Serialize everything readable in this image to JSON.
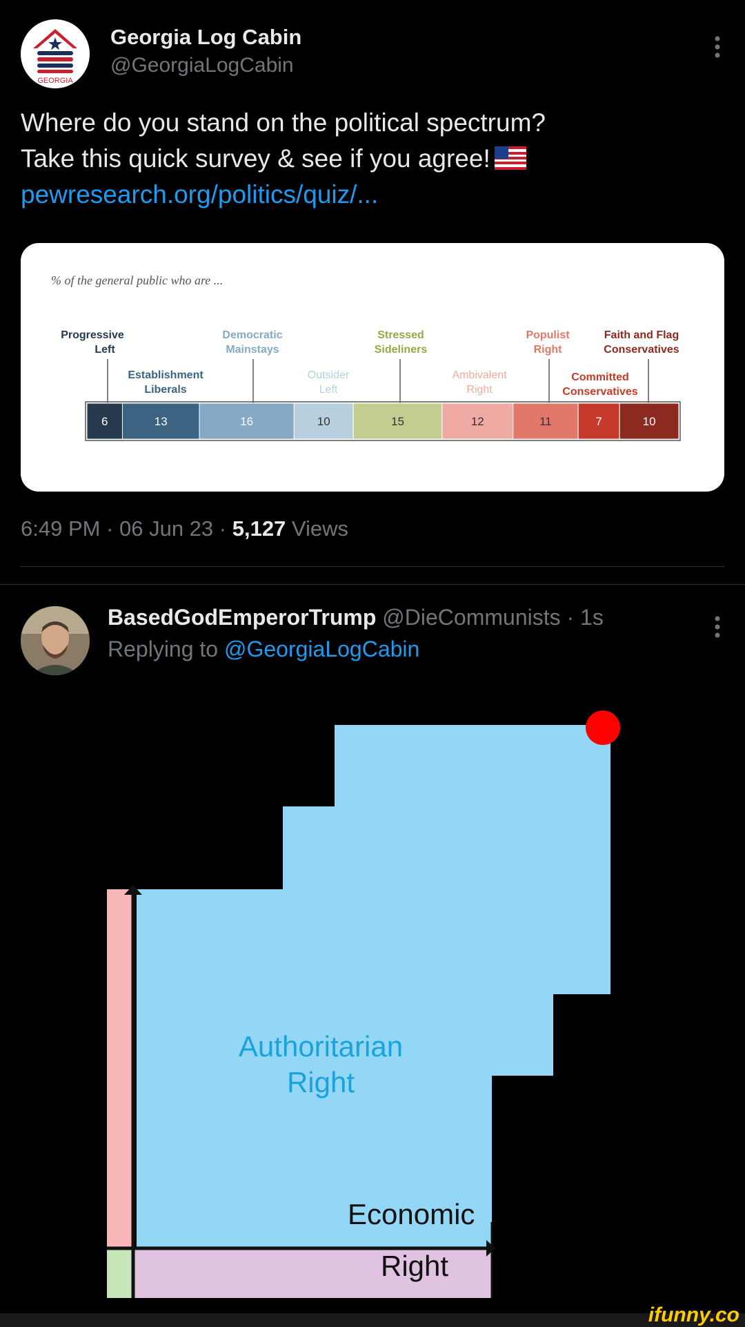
{
  "tweet": {
    "author_name": "Georgia Log Cabin",
    "author_handle": "@GeorgiaLogCabin",
    "avatar_text": "GEORGIA",
    "line1": "Where do you stand on the political spectrum?",
    "line2": "Take this quick survey & see if you agree!",
    "link": "pewresearch.org/politics/quiz/...",
    "timestamp": "6:49 PM · 06 Jun 23 · ",
    "views_count": "5,127",
    "views_label": " Views"
  },
  "card": {
    "caption": "% of the general public who are ...",
    "chart_data": {
      "type": "bar",
      "orientation": "horizontal-stacked",
      "unit": "%",
      "segments": [
        {
          "label": "Progressive Left",
          "value": 6,
          "color": "#26394d"
        },
        {
          "label": "Establishment Liberals",
          "value": 13,
          "color": "#3d6382"
        },
        {
          "label": "Democratic Mainstays",
          "value": 16,
          "color": "#85a9c5"
        },
        {
          "label": "Outsider Left",
          "value": 10,
          "color": "#b8cfe0"
        },
        {
          "label": "Stressed Sideliners",
          "value": 15,
          "color": "#c5cc8f"
        },
        {
          "label": "Ambivalent Right",
          "value": 12,
          "color": "#efaba3"
        },
        {
          "label": "Populist Right",
          "value": 11,
          "color": "#e2786b"
        },
        {
          "label": "Committed Conservatives",
          "value": 7,
          "color": "#c53a2b"
        },
        {
          "label": "Faith and Flag Conservatives",
          "value": 10,
          "color": "#8c2a1f"
        }
      ]
    },
    "labels": {
      "progressive_1": "Progressive",
      "progressive_2": "Left",
      "establishment_1": "Establishment",
      "establishment_2": "Liberals",
      "democratic_1": "Democratic",
      "democratic_2": "Mainstays",
      "outsider_1": "Outsider",
      "outsider_2": "Left",
      "stressed_1": "Stressed",
      "stressed_2": "Sideliners",
      "ambivalent_1": "Ambivalent",
      "ambivalent_2": "Right",
      "populist_1": "Populist",
      "populist_2": "Right",
      "committed_1": "Committed",
      "committed_2": "Conservatives",
      "faith_1": "Faith and Flag",
      "faith_2": "Conservatives"
    }
  },
  "reply": {
    "author_name": "BasedGodEmperorTrump",
    "author_handle": " @DieCommunists · 1s",
    "replying_prefix": "Replying to ",
    "replying_mention": "@GeorgiaLogCabin"
  },
  "compass": {
    "quadrant_label_1": "Authoritarian",
    "quadrant_label_2": "Right",
    "axis_label": "Economic",
    "axis_label_2": "Right",
    "marker_color": "#ff0000",
    "fill_color": "#93d6f6"
  },
  "watermark": "ifunny.co"
}
